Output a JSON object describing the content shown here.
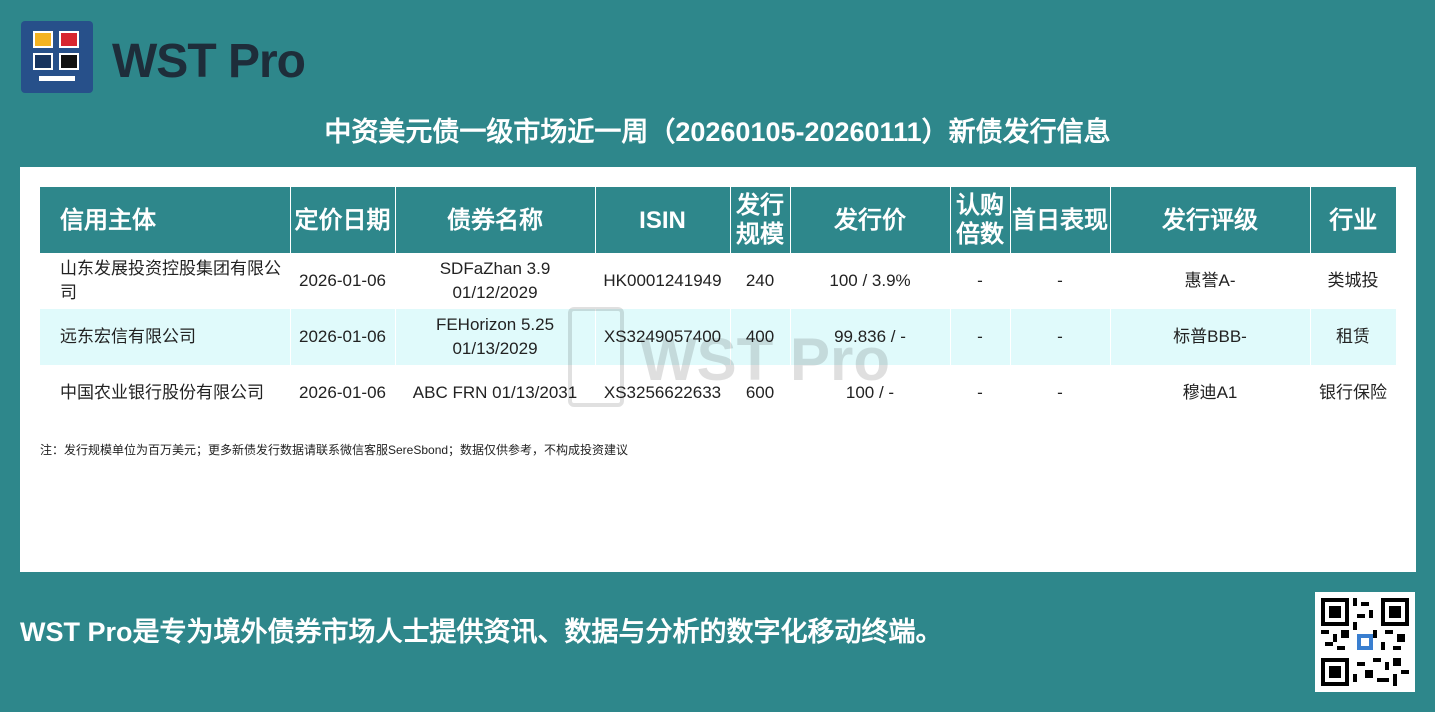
{
  "brand": {
    "name": "WST Pro"
  },
  "title": "中资美元债一级市场近一周（20260105-20260111）新债发行信息",
  "table": {
    "headers": [
      "信用主体",
      "定价日期",
      "债券名称",
      "ISIN",
      "发行规模",
      "发行价",
      "认购倍数",
      "首日表现",
      "发行评级",
      "行业"
    ],
    "rows": [
      [
        "山东发展投资控股集团有限公司",
        "2026-01-06",
        "SDFaZhan 3.9 01/12/2029",
        "HK0001241949",
        "240",
        "100 / 3.9%",
        "-",
        "-",
        "惠誉A-",
        "类城投"
      ],
      [
        "远东宏信有限公司",
        "2026-01-06",
        "FEHorizon 5.25 01/13/2029",
        "XS3249057400",
        "400",
        "99.836 / -",
        "-",
        "-",
        "标普BBB-",
        "租赁"
      ],
      [
        "中国农业银行股份有限公司",
        "2026-01-06",
        "ABC FRN 01/13/2031",
        "XS3256622633",
        "600",
        "100 / -",
        "-",
        "-",
        "穆迪A1",
        "银行保险"
      ]
    ]
  },
  "note": "注：发行规模单位为百万美元；更多新债发行数据请联系微信客服SereSbond；数据仅供参考，不构成投资建议",
  "watermark": "WST Pro",
  "footer": "WST Pro是专为境外债券市场人士提供资讯、数据与分析的数字化移动终端。",
  "colors": {
    "background": "#2e878b",
    "logo": "#27508a",
    "alt_row": "#e0fafb"
  },
  "icons": {
    "logo": "wst-logo-icon",
    "qr": "qr-code-icon"
  }
}
